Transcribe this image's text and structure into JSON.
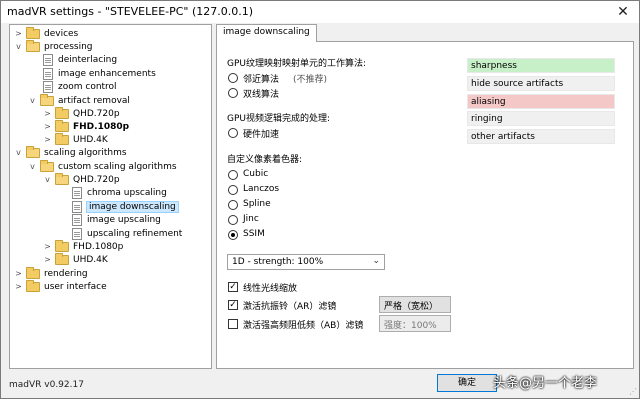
{
  "window": {
    "title": "madVR settings - \"STEVELEE-PC\" (127.0.0.1)",
    "close_glyph": "✕"
  },
  "tree": {
    "devices": "devices",
    "processing": "processing",
    "deinterlacing": "deinterlacing",
    "image_enhancements": "image enhancements",
    "zoom_control": "zoom control",
    "artifact_removal": "artifact removal",
    "ar_qhd": "QHD.720p",
    "ar_fhd": "FHD.1080p",
    "ar_uhd": "UHD.4K",
    "scaling_algorithms": "scaling algorithms",
    "custom_scaling": "custom scaling algorithms",
    "cs_qhd": "QHD.720p",
    "chroma_upscaling": "chroma upscaling",
    "image_downscaling": "image downscaling",
    "image_upscaling": "image upscaling",
    "upscaling_refinement": "upscaling refinement",
    "cs_fhd": "FHD.1080p",
    "cs_uhd": "UHD.4K",
    "rendering": "rendering",
    "user_interface": "user interface"
  },
  "tab": {
    "label": "image downscaling"
  },
  "panel": {
    "gpu_algo_label": "GPU纹理映射映射单元的工作算法:",
    "nearest": "邻近算法",
    "not_recommended": "(不推荐)",
    "bilinear": "双线算法",
    "gpu_shader_label": "GPU视频逻辑完成的处理:",
    "hw_accel": "硬件加速",
    "custom_shader_label": "自定义像素着色器:",
    "cubic": "Cubic",
    "lanczos": "Lanczos",
    "spline": "Spline",
    "jinc": "Jinc",
    "ssim": "SSIM",
    "strength_select": "1D - strength: 100%",
    "linear_light": "线性光线缩放",
    "anti_ringing": "激活抗振铃（AR）滤镜",
    "anti_ringing_mode": "严格（宽松）",
    "anti_bloat": "激活强高频阻低频（AB）滤镜",
    "anti_bloat_strength": "强度：100%",
    "check_glyph": "✓"
  },
  "artifacts": {
    "sharpness": "sharpness",
    "hide_source": "hide source artifacts",
    "aliasing": "aliasing",
    "ringing": "ringing",
    "other": "other artifacts",
    "colors": {
      "good": "#c8f0c8",
      "bad": "#f5c8c8",
      "neutral": "#f0f0f0"
    }
  },
  "footer": {
    "version": "madVR v0.92.17",
    "ok_button": "确定",
    "watermark": "头条@另一个老李"
  },
  "icons": {
    "tree_expand": "tree-expand-icon",
    "tree_collapse": "tree-collapse-icon",
    "folder": "folder-icon",
    "page": "page-icon"
  }
}
